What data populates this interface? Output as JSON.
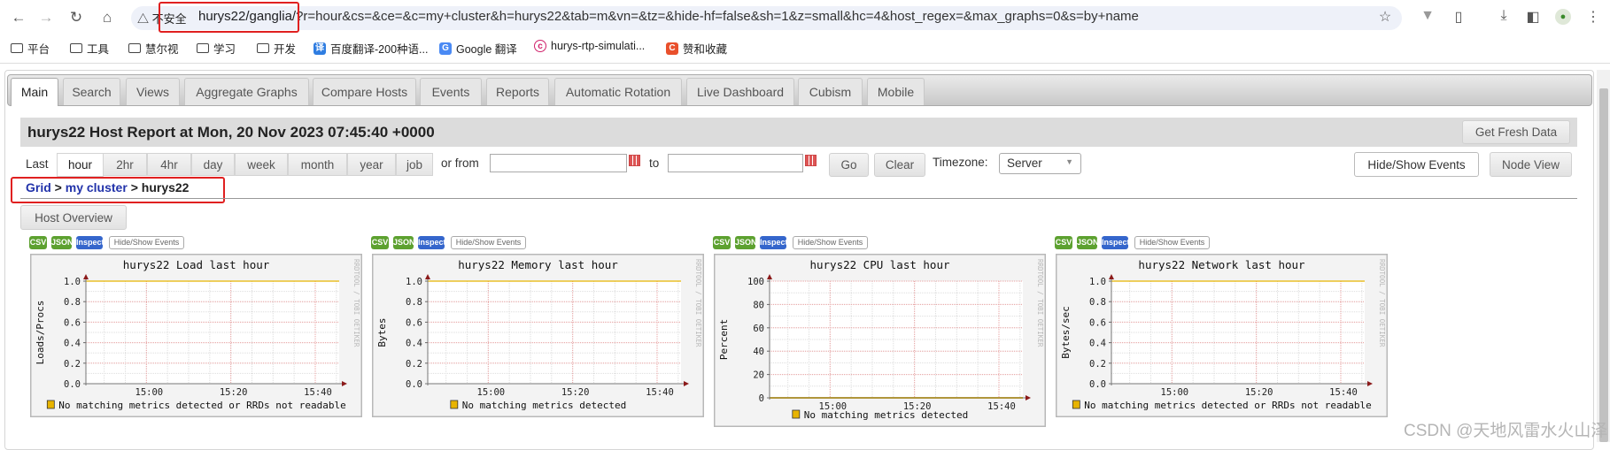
{
  "browser": {
    "security_label": "不安全",
    "url_host": "hurys22/ganglia/",
    "url_rest": "?r=hour&cs=&ce=&c=my+cluster&h=hurys22&tab=m&vn=&tz=&hide-hf=false&sh=1&z=small&hc=4&host_regex=&max_graphs=0&s=by+name",
    "bookmarks": [
      {
        "label": "平台",
        "icon": "folder-icon"
      },
      {
        "label": "工具",
        "icon": "folder-icon"
      },
      {
        "label": "慧尔视",
        "icon": "folder-icon"
      },
      {
        "label": "学习",
        "icon": "folder-icon"
      },
      {
        "label": "开发",
        "icon": "folder-icon"
      },
      {
        "label": "百度翻译-200种语...",
        "icon": "baidu-translate-icon"
      },
      {
        "label": "Google 翻译",
        "icon": "google-translate-icon"
      },
      {
        "label": "hurys-rtp-simulati...",
        "icon": "app-icon"
      },
      {
        "label": "赞和收藏",
        "icon": "csdn-icon"
      }
    ]
  },
  "tabs": [
    "Main",
    "Search",
    "Views",
    "Aggregate Graphs",
    "Compare Hosts",
    "Events",
    "Reports",
    "Automatic Rotation",
    "Live Dashboard",
    "Cubism",
    "Mobile"
  ],
  "active_tab": "Main",
  "header": {
    "title": "hurys22 Host Report at Mon, 20 Nov 2023 07:45:40 +0000",
    "fresh_button": "Get Fresh Data"
  },
  "range": {
    "last_label": "Last",
    "options": [
      "hour",
      "2hr",
      "4hr",
      "day",
      "week",
      "month",
      "year",
      "job"
    ],
    "active": "hour",
    "or_from": "or from",
    "from_value": "",
    "to_label": "to",
    "to_value": "",
    "go": "Go",
    "clear": "Clear",
    "timezone_label": "Timezone:",
    "timezone_value": "Server",
    "hide_show_events": "Hide/Show Events",
    "node_view": "Node View"
  },
  "breadcrumb": {
    "grid": "Grid",
    "sep": ">",
    "cluster": "my cluster",
    "host": "hurys22"
  },
  "host_overview": "Host Overview",
  "graph_buttons": {
    "csv": "CSV",
    "json": "JSON",
    "inspect": "Inspect",
    "events": "Hide/Show Events"
  },
  "colors": {
    "series": "#e8b400",
    "grid_major": "#e8a0a0",
    "grid_minor": "#dddddd",
    "axis": "#8b1a1a",
    "csv_json": "#5da130",
    "inspect": "#3566cc",
    "highlight_box": "#e02020"
  },
  "chart_data": [
    {
      "type": "line",
      "title": "hurys22 Load last hour",
      "ylabel": "Loads/Procs",
      "ylim": [
        0,
        1.0
      ],
      "yticks": [
        "0.0",
        "0.2",
        "0.4",
        "0.6",
        "0.8",
        "1.0"
      ],
      "xticks": [
        "15:00",
        "15:20",
        "15:40"
      ],
      "xlim": [
        "14:45:40",
        "15:45:40"
      ],
      "grid": true,
      "legend": "No matching metrics detected or RRDs not readable",
      "series_value": 1.0,
      "watermark": "RRDTOOL / TOBI OETIKER"
    },
    {
      "type": "line",
      "title": "hurys22 Memory last hour",
      "ylabel": "Bytes",
      "ylim": [
        0,
        1.0
      ],
      "yticks": [
        "0.0",
        "0.2",
        "0.4",
        "0.6",
        "0.8",
        "1.0"
      ],
      "xticks": [
        "15:00",
        "15:20",
        "15:40"
      ],
      "xlim": [
        "14:45:40",
        "15:45:40"
      ],
      "grid": true,
      "legend": "No matching metrics detected",
      "series_value": 1.0,
      "watermark": "RRDTOOL / TOBI OETIKER"
    },
    {
      "type": "line",
      "title": "hurys22 CPU last hour",
      "ylabel": "Percent",
      "ylim": [
        0,
        100
      ],
      "yticks": [
        "0",
        "20",
        "40",
        "60",
        "80",
        "100"
      ],
      "xticks": [
        "15:00",
        "15:20",
        "15:40"
      ],
      "xlim": [
        "14:45:40",
        "15:45:40"
      ],
      "grid": true,
      "legend": "No matching metrics detected",
      "series_value": 0,
      "watermark": "RRDTOOL / TOBI OETIKER"
    },
    {
      "type": "line",
      "title": "hurys22 Network last hour",
      "ylabel": "Bytes/sec",
      "ylim": [
        0,
        1.0
      ],
      "yticks": [
        "0.0",
        "0.2",
        "0.4",
        "0.6",
        "0.8",
        "1.0"
      ],
      "xticks": [
        "15:00",
        "15:20",
        "15:40"
      ],
      "xlim": [
        "14:45:40",
        "15:45:40"
      ],
      "grid": true,
      "legend": "No matching metrics detected or RRDs not readable",
      "series_value": 1.0,
      "watermark": "RRDTOOL / TOBI OETIKER"
    }
  ],
  "watermark": "CSDN @天地风雷水火山泽"
}
